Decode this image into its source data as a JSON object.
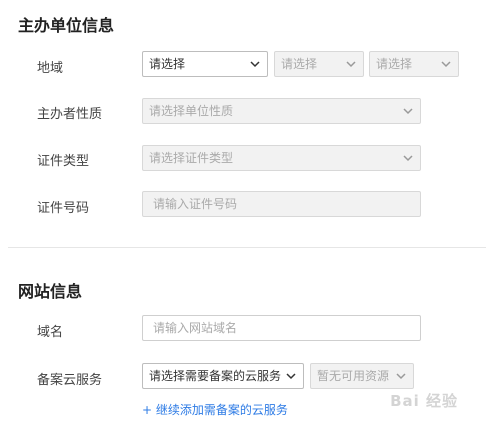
{
  "section1": {
    "title": "主办单位信息",
    "region": {
      "label": "地域",
      "province": "请选择",
      "city": "请选择",
      "district": "请选择"
    },
    "org_nature": {
      "label": "主办者性质",
      "placeholder": "请选择单位性质"
    },
    "cert_type": {
      "label": "证件类型",
      "placeholder": "请选择证件类型"
    },
    "cert_number": {
      "label": "证件号码",
      "placeholder": "请输入证件号码"
    }
  },
  "section2": {
    "title": "网站信息",
    "domain": {
      "label": "域名",
      "placeholder": "请输入网站域名"
    },
    "cloud": {
      "label": "备案云服务",
      "service": "请选择需要备案的云服务",
      "resource": "暂无可用资源",
      "add_link": "+ 继续添加需备案的云服务"
    }
  },
  "watermark": "Bai 经验",
  "colors": {
    "link": "#2d7be5",
    "disabled_bg": "#f2f2f2",
    "border": "#cfcfcf"
  }
}
